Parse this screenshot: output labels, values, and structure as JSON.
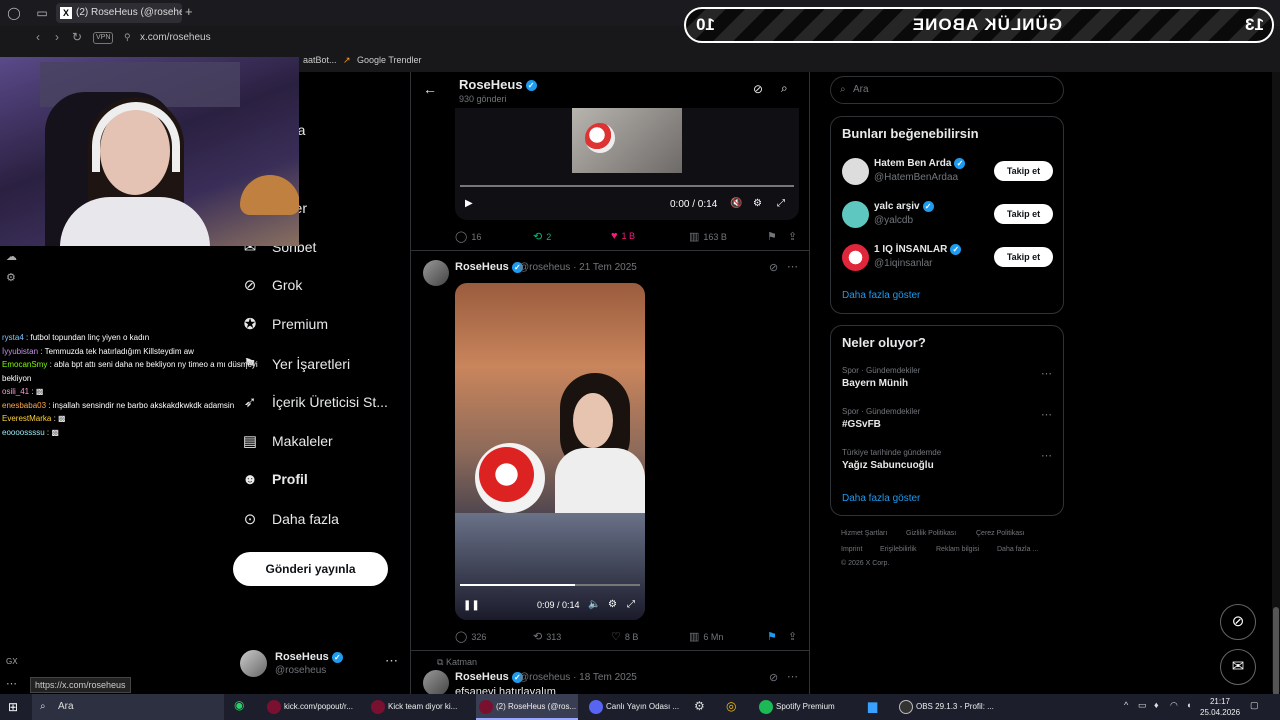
{
  "browser": {
    "tab_title": "(2) RoseHeus (@rosehe",
    "url": "x.com/roseheus",
    "vpn_label": "VPN",
    "bookmarks": [
      "aatBot...",
      "Google Trendler"
    ]
  },
  "overlay": {
    "banner_title": "GÜNLÜK ABONE",
    "banner_left": "13",
    "banner_right": "10",
    "chat": [
      {
        "user": "rysta4",
        "msg": "futbol topundan linç yiyen o kadın"
      },
      {
        "user": "İyyubistan",
        "msg": "Temmuzda tek hatırladığım Killsteydim aw"
      },
      {
        "user": "EmocanSmy",
        "msg": "abla bpt attı seni daha ne bekliyon ny timeo a mı düsmeyi bekliyon"
      },
      {
        "user": "osili_41",
        "msg": ""
      },
      {
        "user": "enesbaba03",
        "msg": "inşallah sensindir ne barbo akskakdkwkdk adamsin"
      },
      {
        "user": "EverestMarka",
        "msg": ""
      },
      {
        "user": "eoooossssu",
        "msg": ""
      }
    ]
  },
  "nav": {
    "items": [
      {
        "label": "sayfa",
        "icon": "home-icon"
      },
      {
        "label": "et",
        "icon": "explore-icon"
      },
      {
        "label": "rimler",
        "icon": "bell-icon"
      },
      {
        "label": "Sohbet",
        "icon": "mail-icon"
      },
      {
        "label": "Grok",
        "icon": "grok-icon"
      },
      {
        "label": "Premium",
        "icon": "premium-icon"
      },
      {
        "label": "Yer İşaretleri",
        "icon": "bookmark-icon"
      },
      {
        "label": "İçerik Üreticisi St...",
        "icon": "rocket-icon"
      },
      {
        "label": "Makaleler",
        "icon": "article-icon"
      },
      {
        "label": "Profil",
        "icon": "profile-icon"
      },
      {
        "label": "Daha fazla",
        "icon": "more-icon"
      }
    ],
    "post_button": "Gönderi yayınla",
    "profile_name": "RoseHeus",
    "profile_handle": "@roseheus"
  },
  "main": {
    "header_name": "RoseHeus",
    "header_count": "930 gönderi",
    "video1": {
      "time": "0:00 / 0:14",
      "progress": 0
    },
    "tweet1_actions": {
      "replies": "16",
      "retweets": "2",
      "likes": "1 B",
      "views": "163 B"
    },
    "tweet2": {
      "name": "RoseHeus",
      "meta": "@roseheus · 21 Tem 2025",
      "time": "0:09 / 0:14",
      "progress": 0.64
    },
    "tweet2_actions": {
      "replies": "326",
      "retweets": "313",
      "likes": "8 B",
      "views": "6 Mn"
    },
    "tweet3": {
      "folder": "Katman",
      "name": "RoseHeus",
      "meta": "@roseheus · 18 Tem 2025",
      "text": "efsaneyi hatırlayalım"
    }
  },
  "right": {
    "search_placeholder": "Ara",
    "suggest_title": "Bunları beğenebilirsin",
    "suggestions": [
      {
        "name": "Hatem Ben Arda",
        "handle": "@HatemBenArdaa",
        "follow": "Takip et"
      },
      {
        "name": "yalc arşiv",
        "handle": "@yalcdb",
        "follow": "Takip et"
      },
      {
        "name": "1 IQ İNSANLAR",
        "handle": "@1iqinsanlar",
        "follow": "Takip et"
      }
    ],
    "show_more": "Daha fazla göster",
    "trends_title": "Neler oluyor?",
    "trends": [
      {
        "category": "Spor · Gündemdekiler",
        "name": "Bayern Münih"
      },
      {
        "category": "Spor · Gündemdekiler",
        "name": "#GSvFB"
      },
      {
        "category": "Türkiye tarihinde gündemde",
        "name": "Yağız Sabuncuoğlu"
      }
    ],
    "trends_more": "Daha fazla göster",
    "footer": [
      "Hizmet Şartları",
      "Gizlilik Politikası",
      "Çerez Politikası",
      "Imprint",
      "Erişilebilirlik",
      "Reklam bilgisi",
      "Daha fazla ...",
      "© 2026 X Corp."
    ]
  },
  "status_url": "https://x.com/roseheus",
  "taskbar": {
    "search": "Ara",
    "apps": [
      "kick.com/popout/r...",
      "Kick team diyor ki...",
      "(2) RoseHeus (@ros...",
      "Canlı Yayın Odası ...",
      "Spotify Premium",
      "OBS 29.1.3 - Profil: ..."
    ],
    "time": "21:17",
    "date": "25.04.2026"
  }
}
